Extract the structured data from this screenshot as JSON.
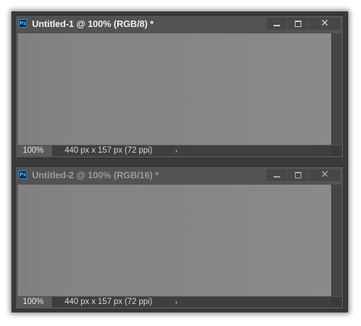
{
  "windows": [
    {
      "title": "Untitled-1 @ 100% (RGB/8) *",
      "icon_text": "Ps",
      "icon": "photoshop-icon",
      "active": true,
      "zoom": "100%",
      "doc_info": "440 px x 157 px (72 ppi)",
      "status_arrow": "›",
      "buttons": {
        "minimize": "minimize-icon",
        "maximize": "maximize-icon",
        "close": "✕"
      }
    },
    {
      "title": "Untitled-2 @ 100% (RGB/16) *",
      "icon_text": "Ps",
      "icon": "photoshop-icon",
      "active": false,
      "zoom": "100%",
      "doc_info": "440 px x 157 px (72 ppi)",
      "status_arrow": "›",
      "buttons": {
        "minimize": "minimize-icon",
        "maximize": "maximize-icon",
        "close": "✕"
      }
    }
  ],
  "colors": {
    "frame": "#3a3a3a",
    "panel": "#535353",
    "canvas": "#858585",
    "active_title": "#f0f0f0",
    "inactive_title": "#9a9a9a"
  }
}
